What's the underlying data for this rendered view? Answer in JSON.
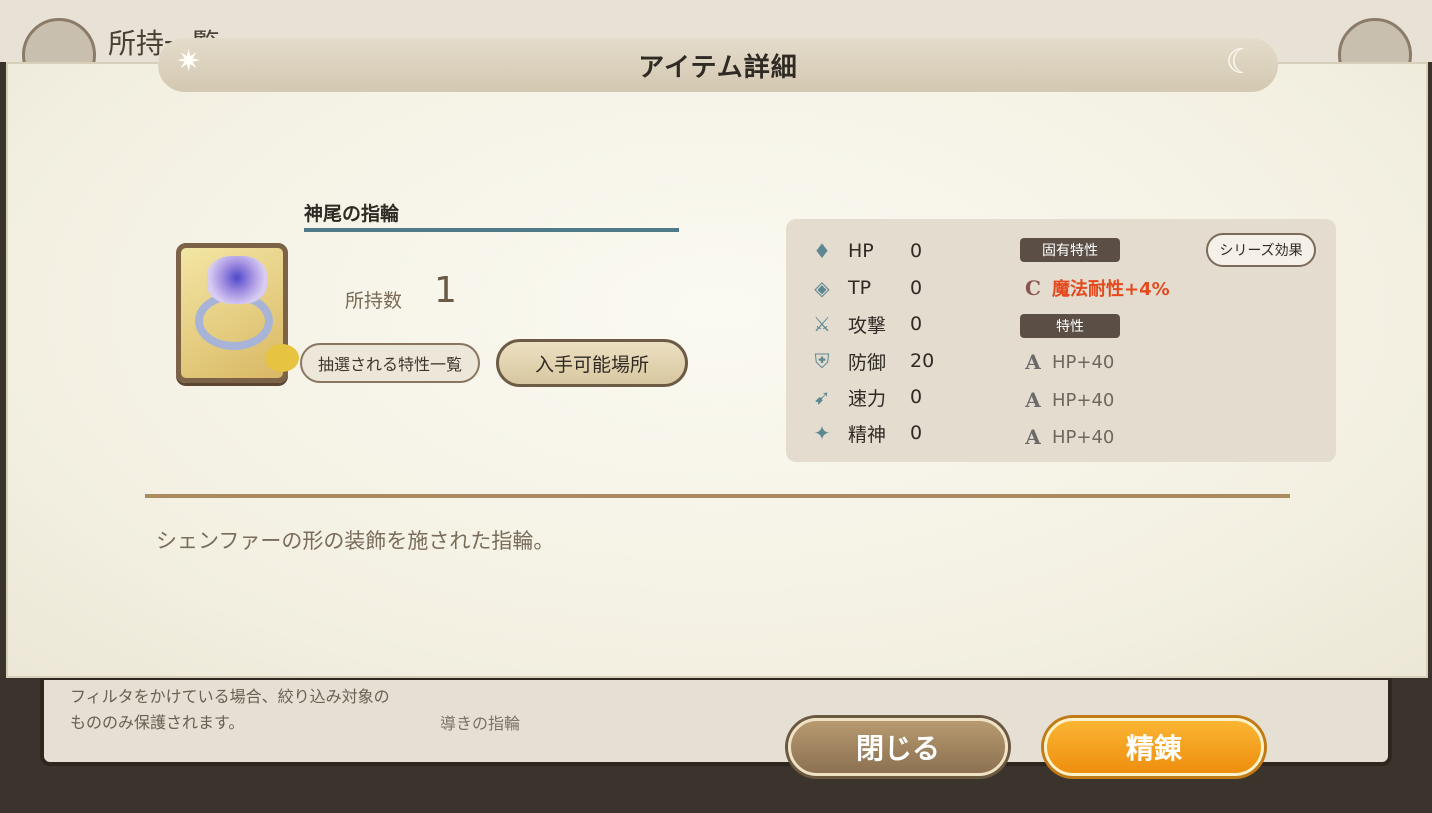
{
  "background": {
    "title": "所持一覧",
    "note": "フィルタをかけている場合、絞り込み対象のもののみ保護されます。",
    "item_label": "導きの指輪"
  },
  "dialog": {
    "title": "アイテム詳細",
    "item_name": "神尾の指輪",
    "owned_label": "所持数",
    "owned_value": "1",
    "traits_button": "抽選される特性一覧",
    "location_button": "入手可能場所",
    "description": "シェンファーの形の装飾を施された指輪。"
  },
  "stats": [
    {
      "icon": "hp-icon",
      "label": "HP",
      "value": "0"
    },
    {
      "icon": "tp-icon",
      "label": "TP",
      "value": "0"
    },
    {
      "icon": "attack-icon",
      "label": "攻撃",
      "value": "0"
    },
    {
      "icon": "defense-icon",
      "label": "防御",
      "value": "20"
    },
    {
      "icon": "speed-icon",
      "label": "速力",
      "value": "0"
    },
    {
      "icon": "spirit-icon",
      "label": "精神",
      "value": "0"
    }
  ],
  "traits": {
    "unique_badge": "固有特性",
    "unique_trait": "魔法耐性+4%",
    "trait_badge": "特性",
    "series_button": "シリーズ効果",
    "list": [
      "HP+40",
      "HP+40",
      "HP+40"
    ]
  },
  "buttons": {
    "close": "閉じる",
    "refine": "精錬"
  },
  "colors": {
    "accent_orange": "#f09514",
    "special_trait": "#e44a1e",
    "name_underline": "#4e7a8a"
  }
}
